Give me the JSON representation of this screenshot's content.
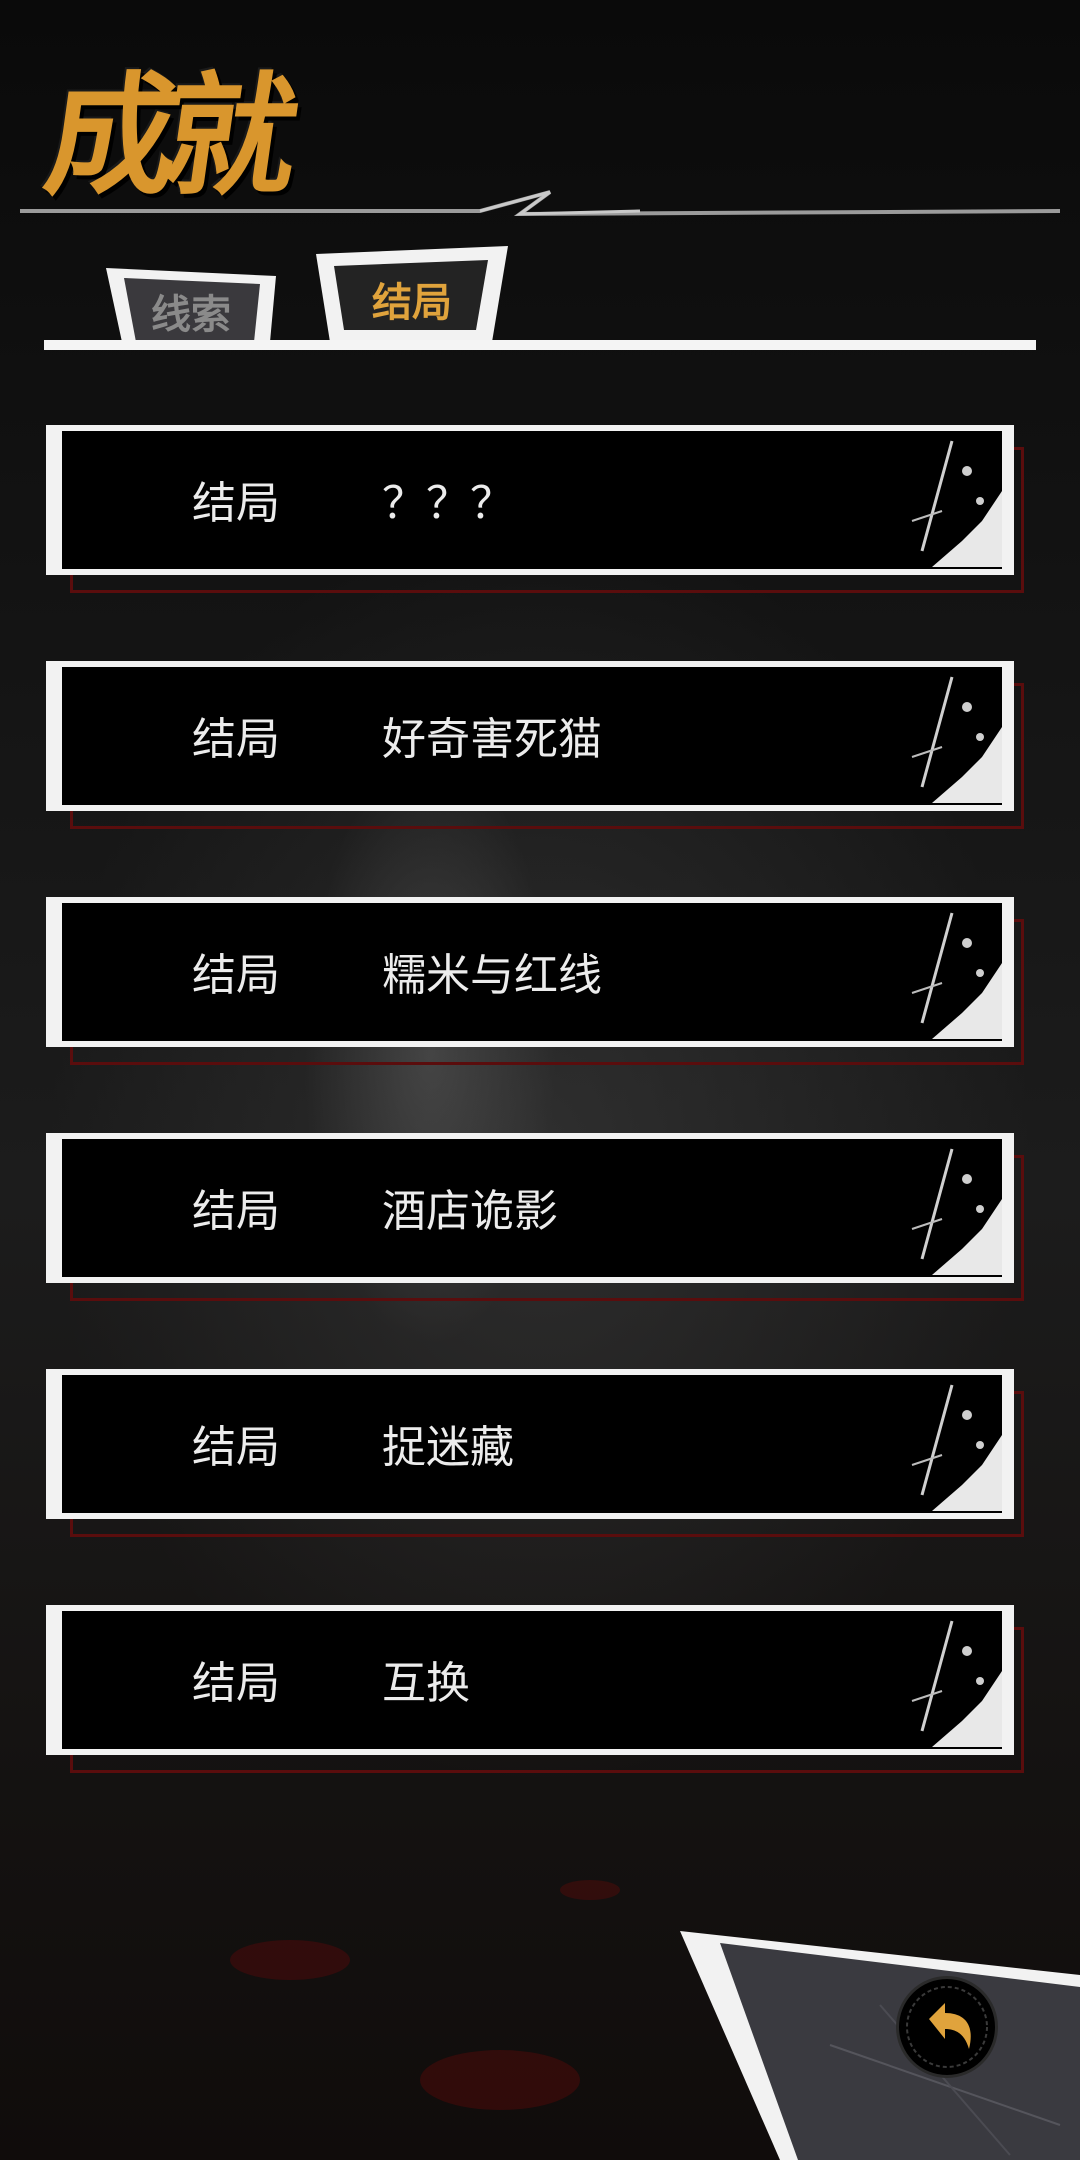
{
  "title": "成就",
  "tabs": [
    {
      "label": "线索",
      "active": false
    },
    {
      "label": "结局",
      "active": true
    }
  ],
  "endings": [
    {
      "label": "结局",
      "name": "？？？"
    },
    {
      "label": "结局",
      "name": "好奇害死猫"
    },
    {
      "label": "结局",
      "name": "糯米与红线"
    },
    {
      "label": "结局",
      "name": "酒店诡影"
    },
    {
      "label": "结局",
      "name": "捉迷藏"
    },
    {
      "label": "结局",
      "name": "互换"
    }
  ],
  "colors": {
    "accent": "#d9962d",
    "item_border": "#f2f2f2",
    "item_shadow": "#5a0d0d",
    "background": "#0b0b0b"
  },
  "icons": {
    "back": "back-arrow-icon"
  }
}
